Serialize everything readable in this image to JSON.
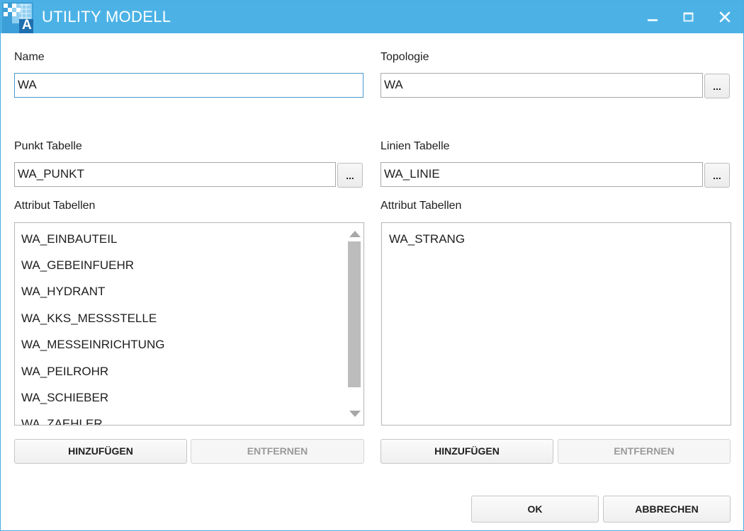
{
  "window": {
    "title": "UTILITY MODELL",
    "app_icon_letter": "A",
    "title_bar_color": "#4cb2e6"
  },
  "form": {
    "name_label": "Name",
    "name_value": "WA",
    "topology_label": "Topologie",
    "topology_value": "WA",
    "point_table_label": "Punkt Tabelle",
    "point_table_value": "WA_PUNKT",
    "line_table_label": "Linien Tabelle",
    "line_table_value": "WA_LINIE",
    "browse_label": "...",
    "point_attr_label": "Attribut Tabellen",
    "point_attr_items": [
      "WA_EINBAUTEIL",
      "WA_GEBEINFUEHR",
      "WA_HYDRANT",
      "WA_KKS_MESSSTELLE",
      "WA_MESSEINRICHTUNG",
      "WA_PEILROHR",
      "WA_SCHIEBER",
      "WA_ZAEHLER"
    ],
    "line_attr_label": "Attribut Tabellen",
    "line_attr_items": [
      "WA_STRANG"
    ],
    "add_label": "HINZUFÜGEN",
    "remove_label": "ENTFERNEN"
  },
  "footer": {
    "ok_label": "OK",
    "cancel_label": "ABBRECHEN"
  }
}
